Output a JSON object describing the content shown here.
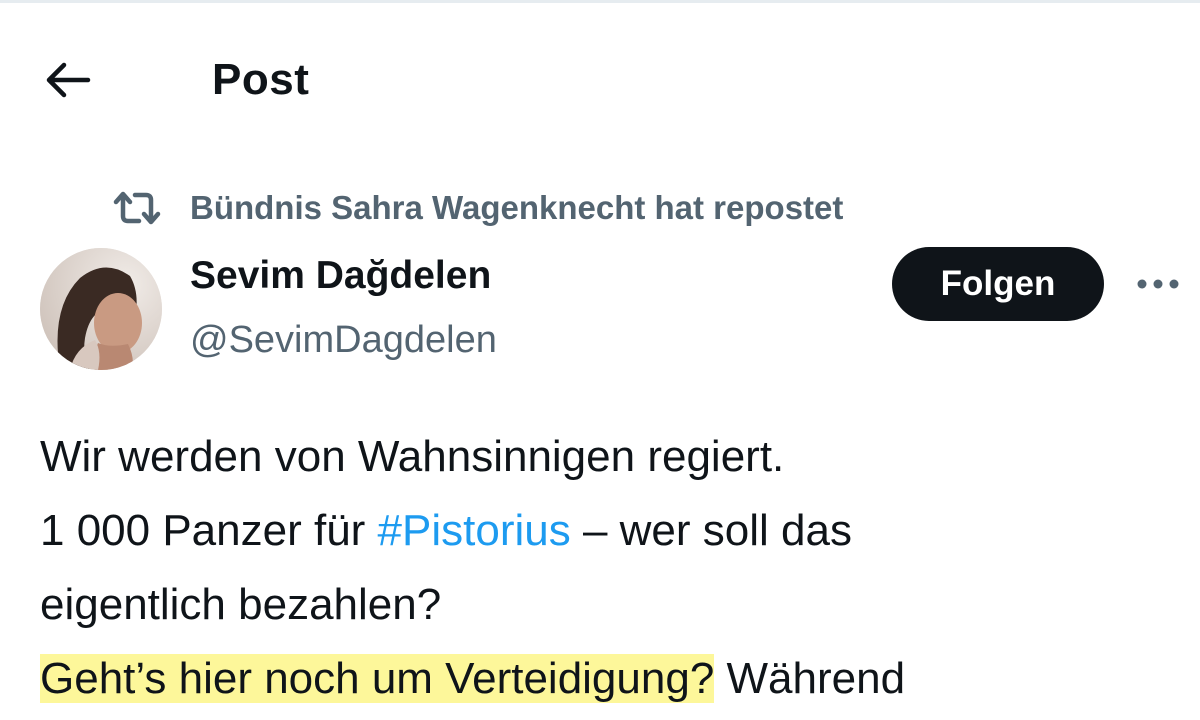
{
  "header": {
    "title": "Post",
    "back_icon": "arrow-left-icon"
  },
  "repost": {
    "icon": "repost-icon",
    "text": "Bündnis Sahra Wagenknecht hat repostet"
  },
  "author": {
    "name": "Sevim Dağdelen",
    "handle": "@SevimDagdelen"
  },
  "actions": {
    "follow_label": "Folgen",
    "more_icon": "more-horizontal-icon"
  },
  "post": {
    "line1": "Wir werden von Wahnsinnigen regiert.",
    "line2_prefix": "1 000 Panzer für ",
    "hashtag": "#Pistorius",
    "line2_suffix": " – wer soll das",
    "line3": "eigentlich bezahlen?",
    "line4_highlight": "Geht’s hier noch um Verteidigung?",
    "line4_rest": " Während"
  },
  "colors": {
    "text": "#0f1419",
    "secondary": "#536471",
    "link": "#1d9bf0",
    "highlight": "#fdf79a",
    "button": "#0f1419"
  }
}
